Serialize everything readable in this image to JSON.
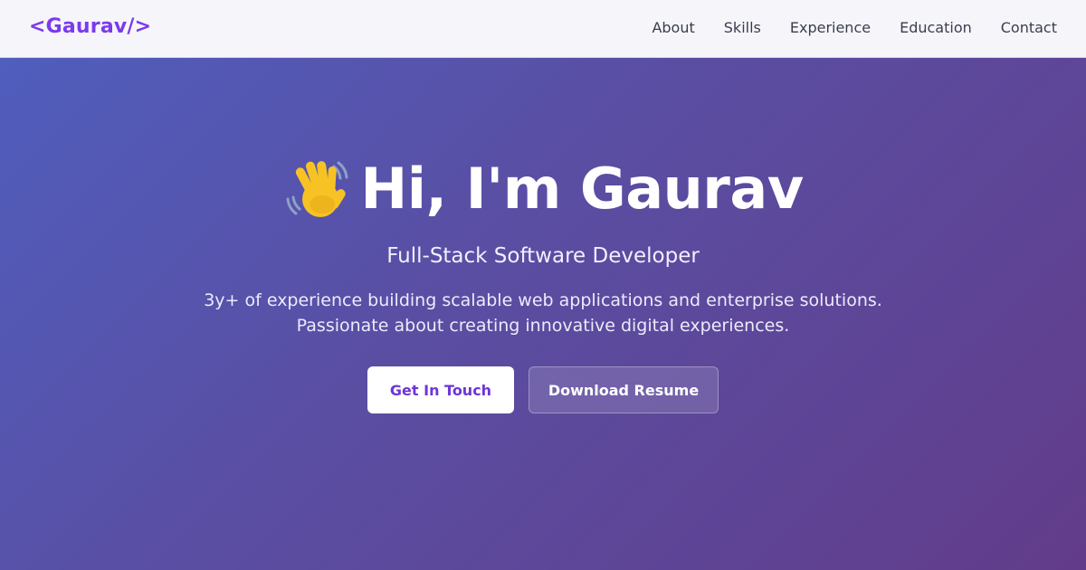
{
  "navbar": {
    "logo": "<Gaurav/>",
    "links": [
      {
        "label": "About"
      },
      {
        "label": "Skills"
      },
      {
        "label": "Experience"
      },
      {
        "label": "Education"
      },
      {
        "label": "Contact"
      }
    ]
  },
  "hero": {
    "icon": "waving-hand-icon",
    "title": "Hi, I'm Gaurav",
    "subtitle": "Full-Stack Software Developer",
    "description_lines": [
      "3y+ of experience building scalable web applications and enterprise solutions.",
      "Passionate about creating innovative digital experiences."
    ],
    "buttons": {
      "primary_label": "Get In Touch",
      "secondary_label": "Download Resume"
    }
  },
  "colors": {
    "accent": "#7c3aed",
    "gradient_start": "#4f5fbf",
    "gradient_end": "#623c8a"
  }
}
